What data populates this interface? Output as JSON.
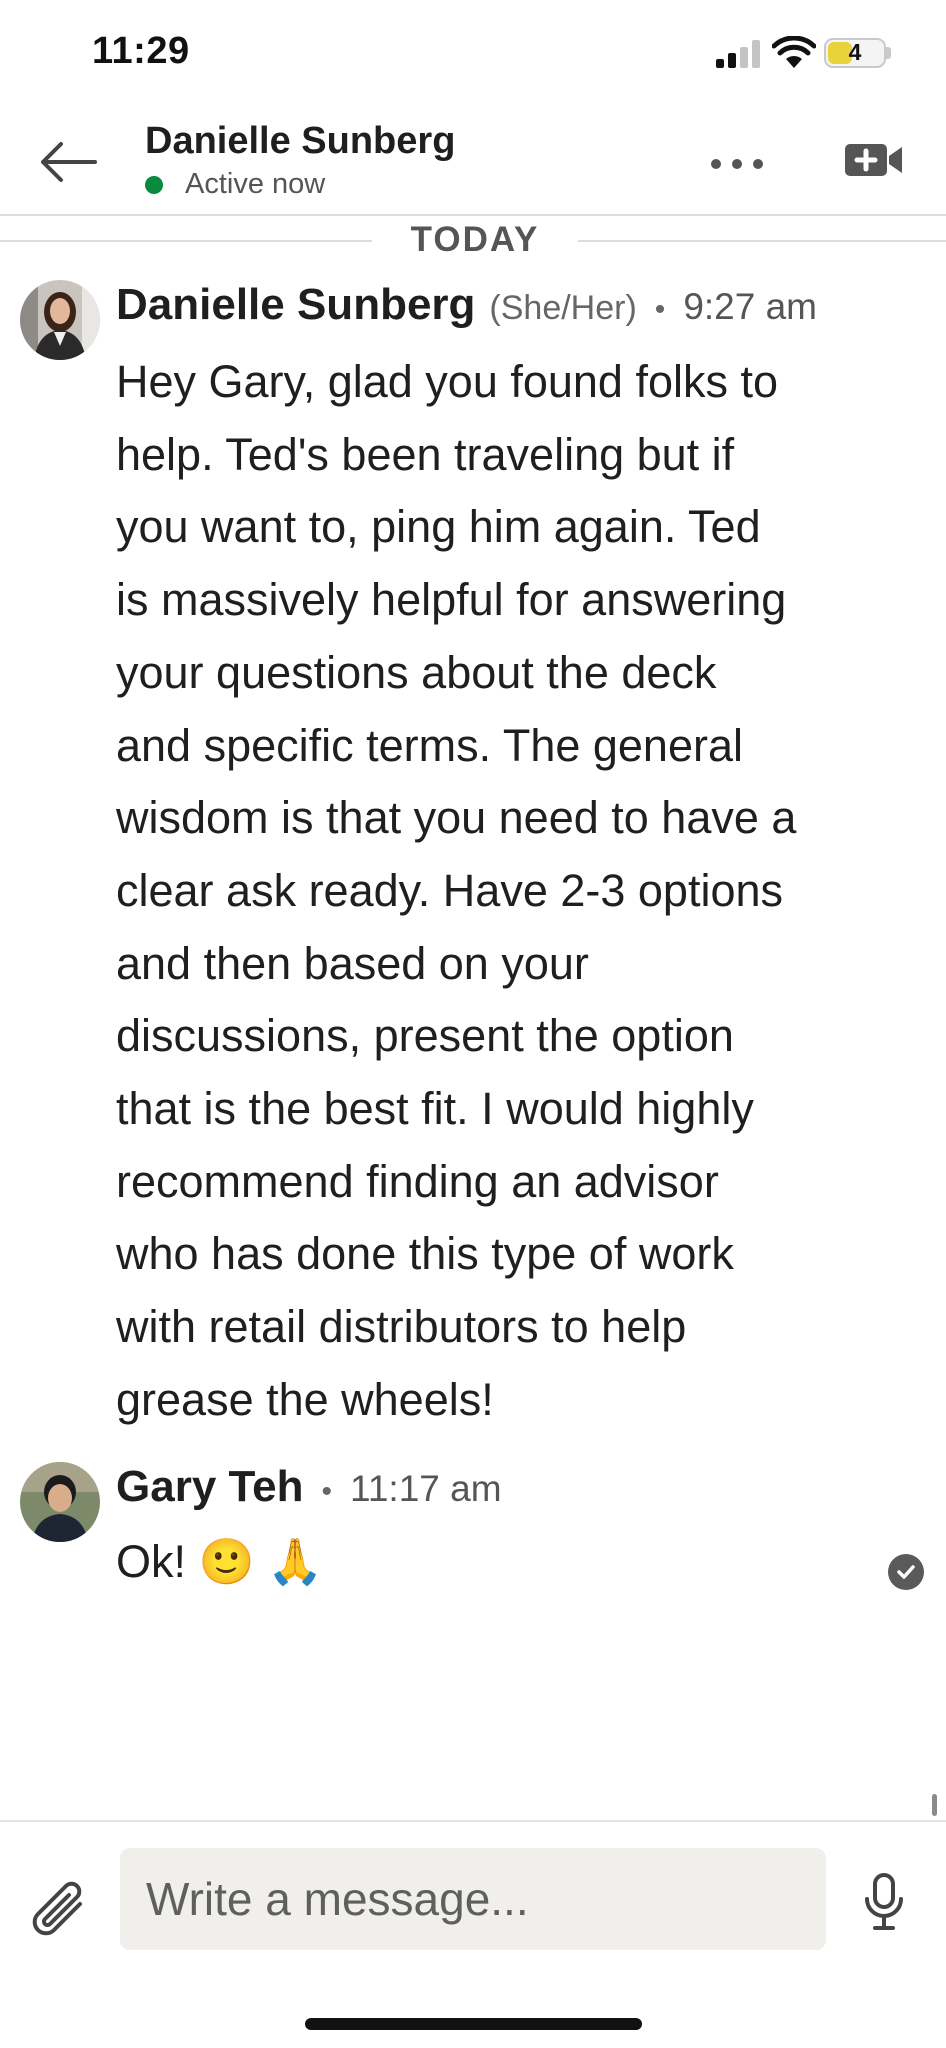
{
  "status_bar": {
    "time": "11:29",
    "battery_level": "4",
    "battery_color": "#e8d33d",
    "icons": [
      "signal-icon",
      "wifi-icon",
      "battery-icon"
    ]
  },
  "header": {
    "contact_name": "Danielle Sunberg",
    "presence": "Active now",
    "presence_color": "#0a8a3d",
    "icons": [
      "back-arrow-icon",
      "more-icon",
      "video-call-icon"
    ]
  },
  "conversation": {
    "day_label": "TODAY",
    "messages": [
      {
        "sender": "Danielle Sunberg",
        "pronouns": "(She/Her)",
        "separator": "•",
        "time": "9:27 am",
        "lines": [
          "Hey Gary, glad you found folks to",
          "help. Ted's been traveling but if",
          "you want to, ping him again. Ted",
          "is massively helpful for answering",
          "your questions about the deck",
          "and specific terms. The general",
          "wisdom is that you need to have a",
          "clear ask ready. Have 2-3 options",
          "and then based on your",
          "discussions, present the option",
          "that is the best fit. I would highly",
          "recommend finding an advisor",
          "who has done this type of work",
          "with retail distributors to help",
          "grease the wheels!"
        ]
      },
      {
        "sender": "Gary Teh",
        "separator": "•",
        "time": "11:17 am",
        "text": "Ok! 🙂 🙏",
        "status_icon": "read-receipt-icon"
      }
    ]
  },
  "composer": {
    "placeholder": "Write a message...",
    "value": "",
    "icons": [
      "attach-icon",
      "microphone-icon"
    ]
  }
}
